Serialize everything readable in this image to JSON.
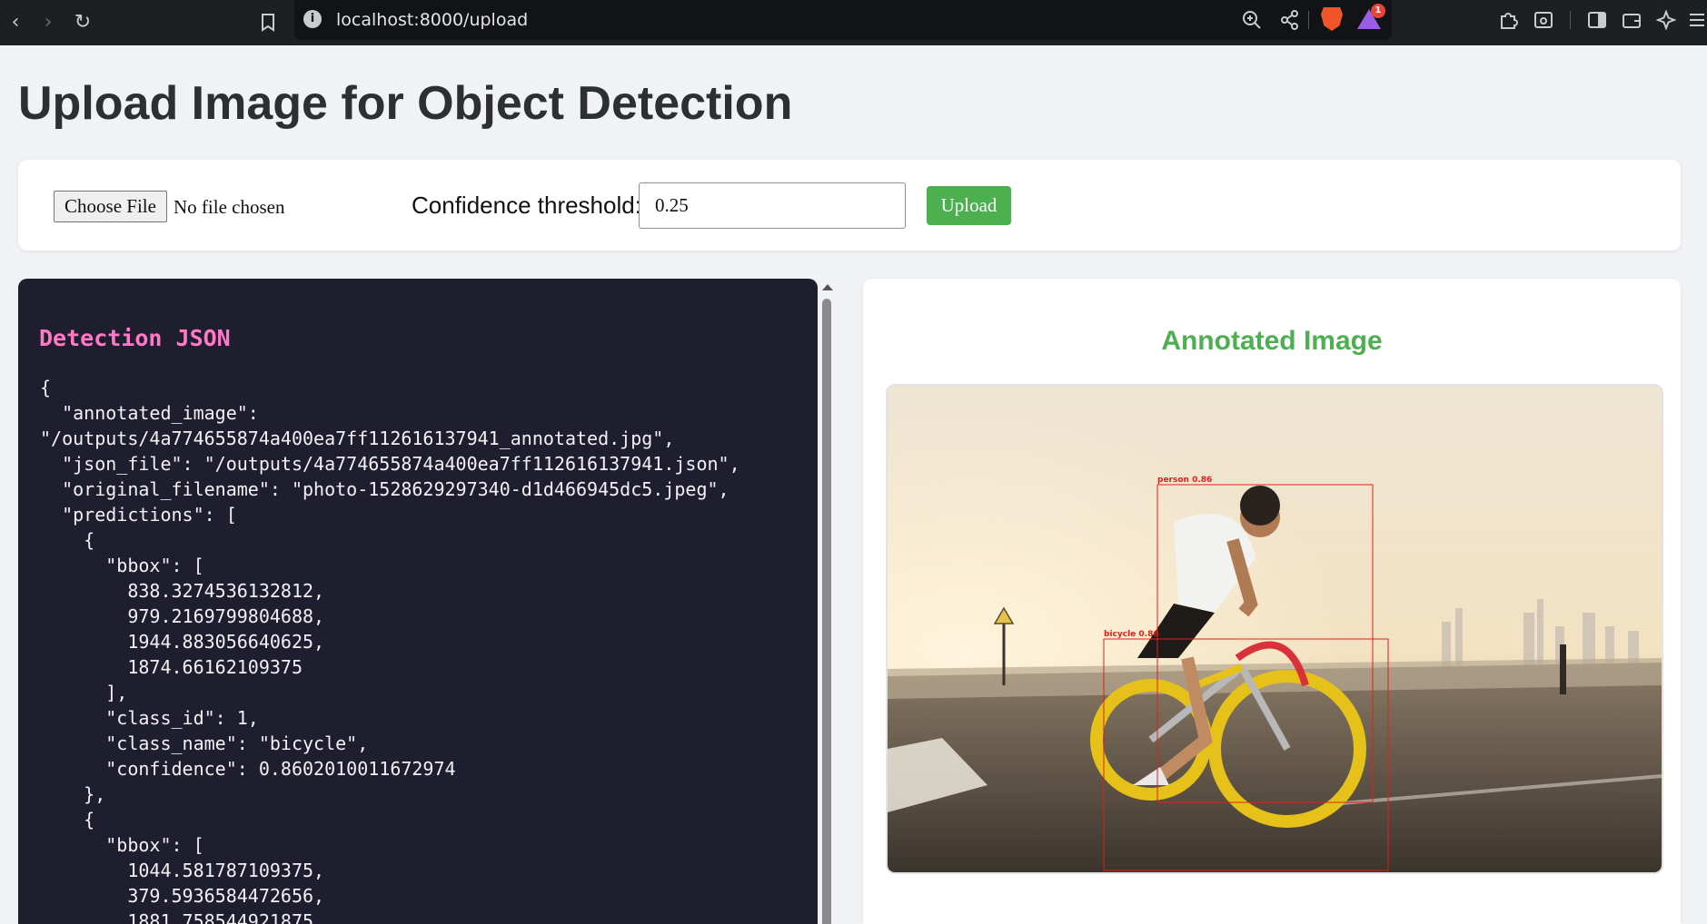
{
  "browser": {
    "url": "localhost:8000/upload",
    "icons": [
      "back-icon",
      "forward-icon",
      "reload-icon",
      "bookmark-icon",
      "site-info-icon",
      "zoom-icon",
      "share-icon",
      "brave-shields-icon",
      "brave-rewards-icon",
      "extensions-icon",
      "reader-icon",
      "sidebar-icon",
      "wallet-icon",
      "leo-icon",
      "menu-icon"
    ],
    "rewards_badge": "1"
  },
  "page": {
    "title": "Upload Image for Object Detection"
  },
  "form": {
    "choose_file_label": "Choose File",
    "file_status": "No file chosen",
    "confidence_label": "Confidence threshold:",
    "confidence_value": "0.25",
    "upload_label": "Upload"
  },
  "json_panel": {
    "title": "Detection JSON",
    "content": "{\n  \"annotated_image\":\n\"/outputs/4a774655874a400ea7ff112616137941_annotated.jpg\",\n  \"json_file\": \"/outputs/4a774655874a400ea7ff112616137941.json\",\n  \"original_filename\": \"photo-1528629297340-d1d466945dc5.jpeg\",\n  \"predictions\": [\n    {\n      \"bbox\": [\n        838.3274536132812,\n        979.2169799804688,\n        1944.883056640625,\n        1874.66162109375\n      ],\n      \"class_id\": 1,\n      \"class_name\": \"bicycle\",\n      \"confidence\": 0.8602010011672974\n    },\n    {\n      \"bbox\": [\n        1044.581787109375,\n        379.5936584472656,\n        1881.758544921875"
  },
  "image_panel": {
    "title": "Annotated Image",
    "detections": [
      {
        "label": "person 0.86",
        "color": "#e0201a"
      },
      {
        "label": "bicycle 0.86",
        "color": "#e0201a"
      }
    ]
  },
  "colors": {
    "accent": "#4caf50",
    "json_title": "#ff79c6",
    "json_bg": "#1e1e2e",
    "bbox": "#e0201a"
  }
}
